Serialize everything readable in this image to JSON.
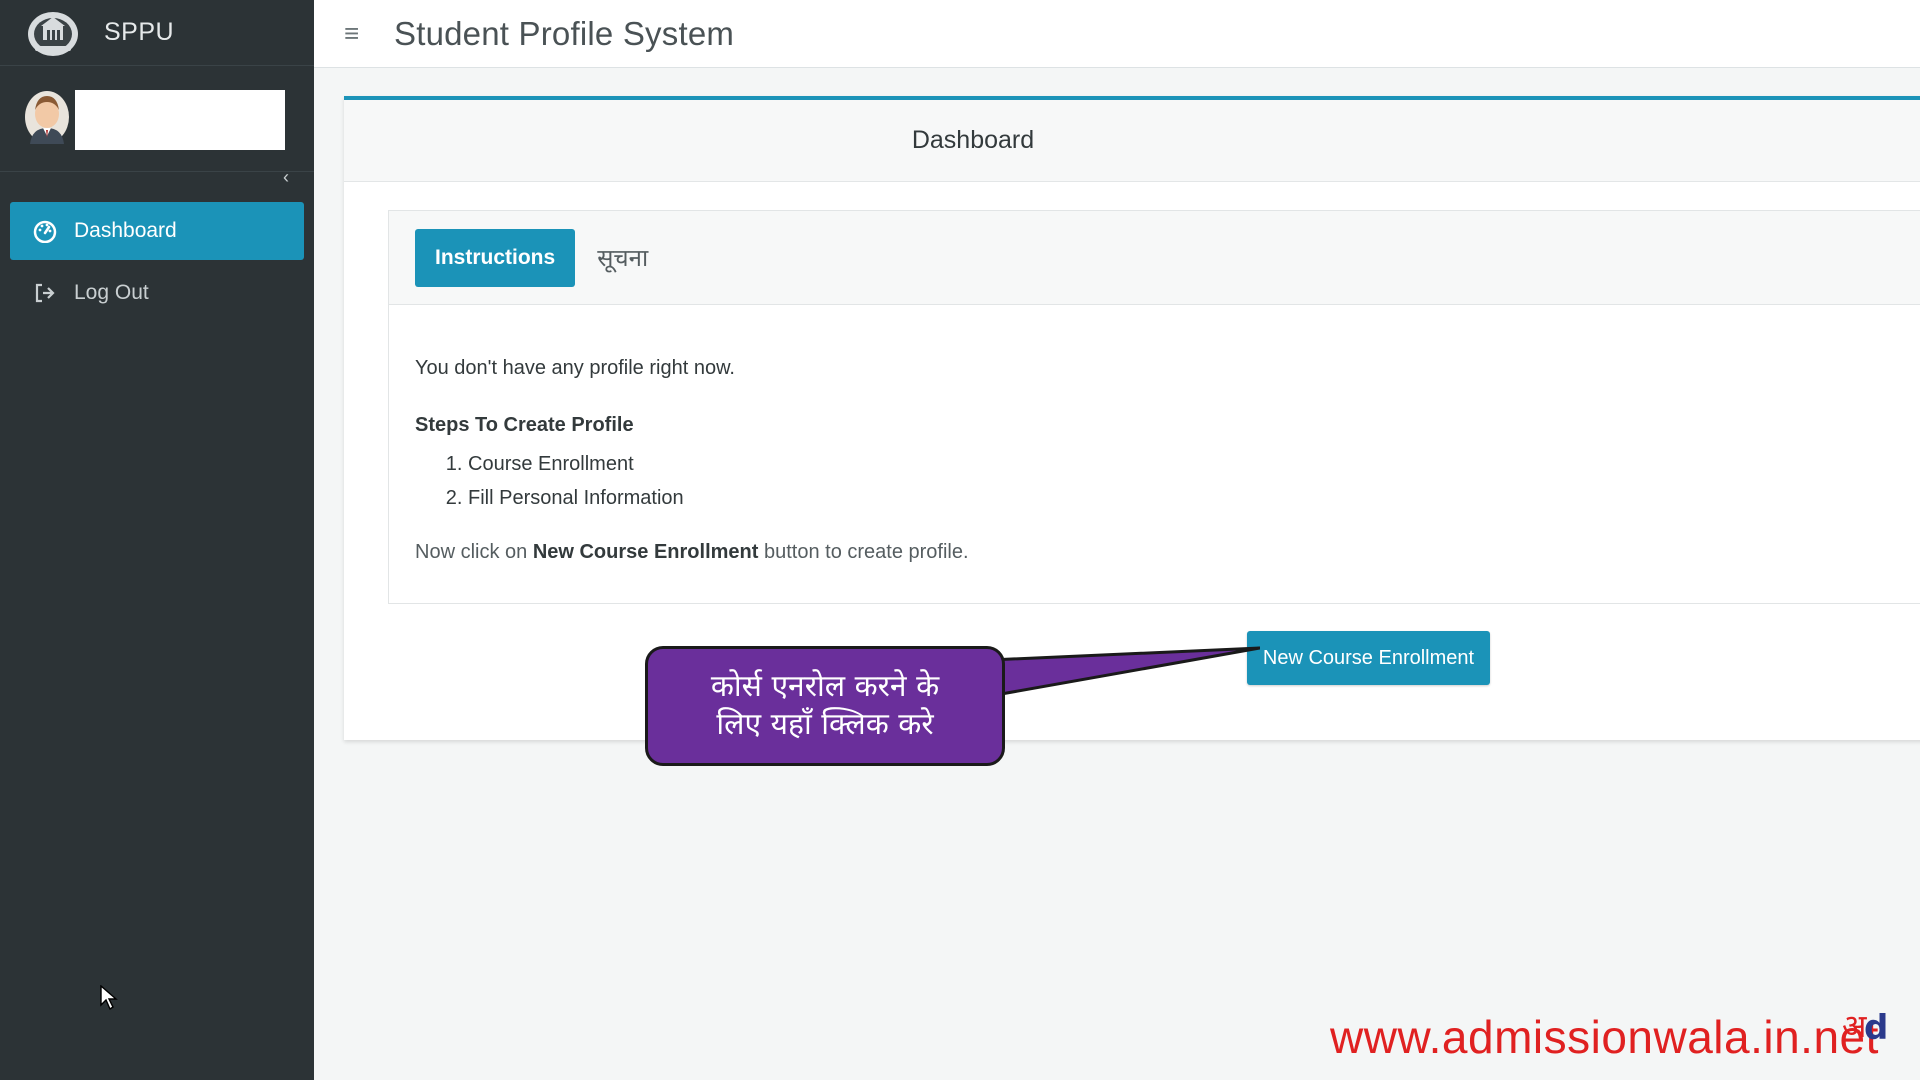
{
  "sidebar": {
    "brand": {
      "text": "SPPU",
      "logo_icon": "university-emblem-icon"
    },
    "user": {
      "avatar_icon": "user-avatar-icon",
      "close_icon": "close-icon",
      "close_glyph": "‹"
    },
    "nav": [
      {
        "label": "Dashboard",
        "icon": "dashboard-icon",
        "active": true
      },
      {
        "label": "Log Out",
        "icon": "logout-icon",
        "active": false
      }
    ]
  },
  "topbar": {
    "menu_icon": "hamburger-icon",
    "menu_glyph": "≡",
    "title": "Student Profile System"
  },
  "card": {
    "title": "Dashboard",
    "tabs": [
      {
        "label": "Instructions",
        "active": true
      },
      {
        "label": "सूचना",
        "active": false
      }
    ],
    "body": {
      "intro": "You don't have any profile right now.",
      "steps_title": "Steps To Create Profile",
      "steps": [
        "Course Enrollment",
        "Fill Personal Information"
      ],
      "final_prefix": "Now click on ",
      "final_bold": "New Course Enrollment",
      "final_suffix": " button to create profile."
    },
    "enroll_button": "New Course Enrollment"
  },
  "callout": {
    "line1": "कोर्स एनरोल करने के",
    "line2": "लिए यहाँ क्लिक करे"
  },
  "watermark": {
    "text": "www.admissionwala.in.net",
    "logo_icon": "admissionwala-logo-icon",
    "logo_text_a": "अ",
    "logo_text_b": "d"
  },
  "colors": {
    "sidebar_bg": "#2c3336",
    "accent": "#1b93b8",
    "callout_bg": "#6a2f9b",
    "watermark": "#e02121"
  }
}
